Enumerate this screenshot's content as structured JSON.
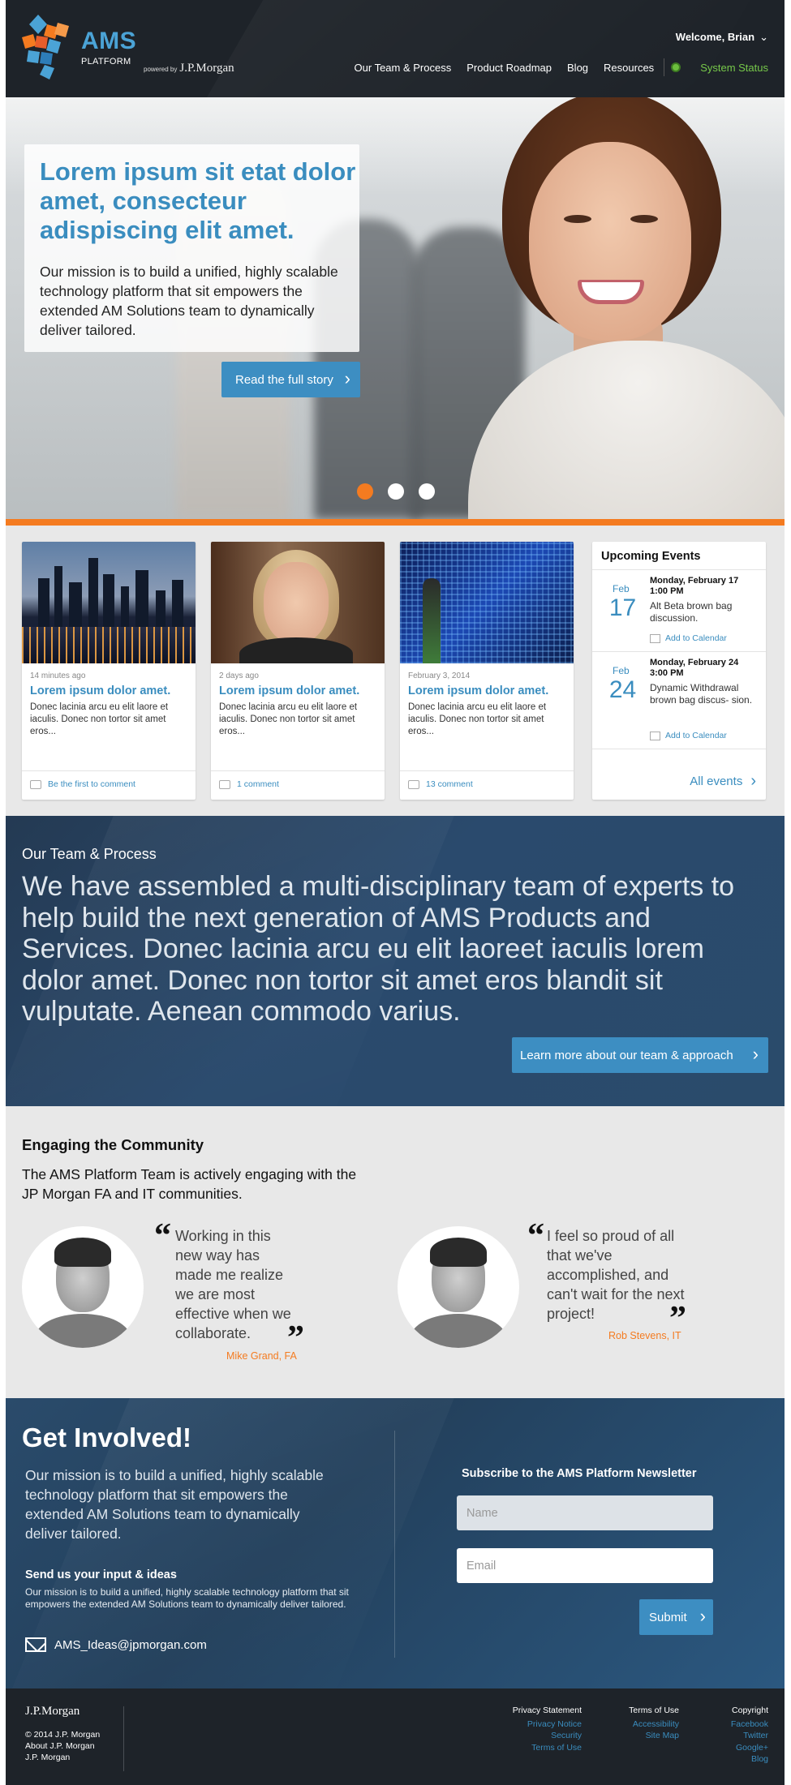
{
  "header": {
    "brand_title": "AMS",
    "brand_sub": "PLATFORM",
    "powered_by": "powered by",
    "powered_brand": "J.P.Morgan",
    "welcome": "Welcome, Brian",
    "nav": [
      "Our Team & Process",
      "Product Roadmap",
      "Blog",
      "Resources"
    ],
    "status": "System Status"
  },
  "hero": {
    "title": "Lorem ipsum sit etat dolor amet, consecteur adispiscing elit amet.",
    "text": "Our mission is to build a unified, highly scalable technology platform that sit empowers the extended AM Solutions team to dynamically deliver tailored.",
    "button": "Read the full story"
  },
  "cards": [
    {
      "meta": "14 minutes ago",
      "title": "Lorem ipsum dolor amet.",
      "text": "Donec lacinia arcu eu elit laore et iaculis. Donec non tortor sit amet eros...",
      "comment": "Be the first to comment"
    },
    {
      "meta": "2 days ago",
      "title": "Lorem ipsum dolor amet.",
      "text": "Donec lacinia arcu eu elit laore et iaculis. Donec non tortor sit amet eros...",
      "comment": "1 comment"
    },
    {
      "meta": "February 3, 2014",
      "title": "Lorem ipsum dolor amet.",
      "text": "Donec lacinia arcu eu elit laore et iaculis. Donec non tortor sit amet eros...",
      "comment": "13 comment"
    }
  ],
  "events": {
    "title": "Upcoming Events",
    "items": [
      {
        "month": "Feb",
        "day": "17",
        "date": "Monday, February 17",
        "time": "1:00 PM",
        "desc": "Alt Beta brown bag discussion.",
        "cal": "Add to Calendar"
      },
      {
        "month": "Feb",
        "day": "24",
        "date": "Monday, February 24",
        "time": "3:00 PM",
        "desc": "Dynamic Withdrawal brown bag discus- sion.",
        "cal": "Add to Calendar"
      }
    ],
    "all": "All events"
  },
  "team": {
    "heading": "Our Team & Process",
    "text": "We have assembled a multi-disciplinary team of experts to help build the next generation of AMS Products and Services. Donec lacinia arcu eu elit laoreet iaculis lorem dolor amet. Donec non tortor sit amet eros blandit sit vulputate. Aenean commodo varius.",
    "button": "Learn more about our team & approach"
  },
  "community": {
    "title": "Engaging the Community",
    "text": "The AMS Platform Team is actively engaging with the JP Morgan FA and IT communities.",
    "quotes": [
      {
        "text": "Working in this new way has made me realize we are most effective when we collaborate.",
        "author": "Mike Grand, FA"
      },
      {
        "text": "I feel so proud of all that we've accomplished, and can't wait for the next project!",
        "author": "Rob Stevens, IT"
      }
    ]
  },
  "involved": {
    "title": "Get Involved!",
    "text": "Our mission is to build a unified, highly scalable technology platform that sit empowers the extended AM Solutions team to dynamically deliver tailored.",
    "sub_title": "Send us your input & ideas",
    "sub_text": "Our mission is to build a unified, highly scalable technology platform that sit empowers the extended AM Solutions team to dynamically deliver tailored.",
    "email": "AMS_Ideas@jpmorgan.com",
    "newsletter_title": "Subscribe to the AMS Platform Newsletter",
    "name_placeholder": "Name",
    "email_placeholder": "Email",
    "submit": "Submit"
  },
  "footer": {
    "logo": "J.P.Morgan",
    "copy": [
      "© 2014 J.P. Morgan",
      "About J.P. Morgan",
      "J.P. Morgan"
    ],
    "col1": {
      "heading": "Privacy Statement",
      "links": [
        "Privacy Notice",
        "Security",
        "Terms of Use"
      ]
    },
    "col2": {
      "heading": "Terms of Use",
      "links": [
        "Accessibility",
        "Site Map"
      ]
    },
    "col3": {
      "heading": "Copyright",
      "links": [
        "Facebook",
        "Twitter",
        "Google+",
        "Blog"
      ]
    }
  },
  "colors": {
    "accent_blue": "#3d8ec2",
    "accent_orange": "#f47b20",
    "status_green": "#6cbf3e",
    "header_bg": "#1e2329"
  }
}
